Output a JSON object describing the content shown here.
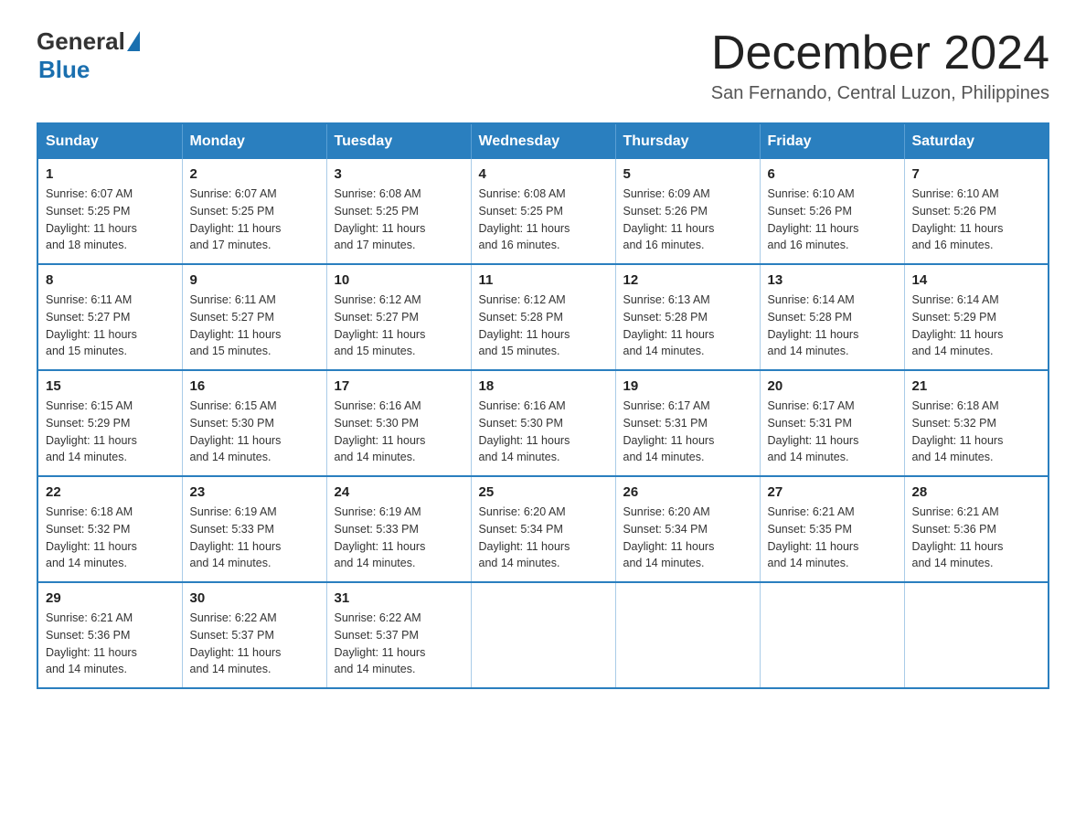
{
  "logo": {
    "general": "General",
    "blue": "Blue",
    "triangle": "▶"
  },
  "title": {
    "month_year": "December 2024",
    "location": "San Fernando, Central Luzon, Philippines"
  },
  "weekdays": [
    "Sunday",
    "Monday",
    "Tuesday",
    "Wednesday",
    "Thursday",
    "Friday",
    "Saturday"
  ],
  "weeks": [
    [
      {
        "day": "1",
        "sunrise": "6:07 AM",
        "sunset": "5:25 PM",
        "daylight": "11 hours and 18 minutes."
      },
      {
        "day": "2",
        "sunrise": "6:07 AM",
        "sunset": "5:25 PM",
        "daylight": "11 hours and 17 minutes."
      },
      {
        "day": "3",
        "sunrise": "6:08 AM",
        "sunset": "5:25 PM",
        "daylight": "11 hours and 17 minutes."
      },
      {
        "day": "4",
        "sunrise": "6:08 AM",
        "sunset": "5:25 PM",
        "daylight": "11 hours and 16 minutes."
      },
      {
        "day": "5",
        "sunrise": "6:09 AM",
        "sunset": "5:26 PM",
        "daylight": "11 hours and 16 minutes."
      },
      {
        "day": "6",
        "sunrise": "6:10 AM",
        "sunset": "5:26 PM",
        "daylight": "11 hours and 16 minutes."
      },
      {
        "day": "7",
        "sunrise": "6:10 AM",
        "sunset": "5:26 PM",
        "daylight": "11 hours and 16 minutes."
      }
    ],
    [
      {
        "day": "8",
        "sunrise": "6:11 AM",
        "sunset": "5:27 PM",
        "daylight": "11 hours and 15 minutes."
      },
      {
        "day": "9",
        "sunrise": "6:11 AM",
        "sunset": "5:27 PM",
        "daylight": "11 hours and 15 minutes."
      },
      {
        "day": "10",
        "sunrise": "6:12 AM",
        "sunset": "5:27 PM",
        "daylight": "11 hours and 15 minutes."
      },
      {
        "day": "11",
        "sunrise": "6:12 AM",
        "sunset": "5:28 PM",
        "daylight": "11 hours and 15 minutes."
      },
      {
        "day": "12",
        "sunrise": "6:13 AM",
        "sunset": "5:28 PM",
        "daylight": "11 hours and 14 minutes."
      },
      {
        "day": "13",
        "sunrise": "6:14 AM",
        "sunset": "5:28 PM",
        "daylight": "11 hours and 14 minutes."
      },
      {
        "day": "14",
        "sunrise": "6:14 AM",
        "sunset": "5:29 PM",
        "daylight": "11 hours and 14 minutes."
      }
    ],
    [
      {
        "day": "15",
        "sunrise": "6:15 AM",
        "sunset": "5:29 PM",
        "daylight": "11 hours and 14 minutes."
      },
      {
        "day": "16",
        "sunrise": "6:15 AM",
        "sunset": "5:30 PM",
        "daylight": "11 hours and 14 minutes."
      },
      {
        "day": "17",
        "sunrise": "6:16 AM",
        "sunset": "5:30 PM",
        "daylight": "11 hours and 14 minutes."
      },
      {
        "day": "18",
        "sunrise": "6:16 AM",
        "sunset": "5:30 PM",
        "daylight": "11 hours and 14 minutes."
      },
      {
        "day": "19",
        "sunrise": "6:17 AM",
        "sunset": "5:31 PM",
        "daylight": "11 hours and 14 minutes."
      },
      {
        "day": "20",
        "sunrise": "6:17 AM",
        "sunset": "5:31 PM",
        "daylight": "11 hours and 14 minutes."
      },
      {
        "day": "21",
        "sunrise": "6:18 AM",
        "sunset": "5:32 PM",
        "daylight": "11 hours and 14 minutes."
      }
    ],
    [
      {
        "day": "22",
        "sunrise": "6:18 AM",
        "sunset": "5:32 PM",
        "daylight": "11 hours and 14 minutes."
      },
      {
        "day": "23",
        "sunrise": "6:19 AM",
        "sunset": "5:33 PM",
        "daylight": "11 hours and 14 minutes."
      },
      {
        "day": "24",
        "sunrise": "6:19 AM",
        "sunset": "5:33 PM",
        "daylight": "11 hours and 14 minutes."
      },
      {
        "day": "25",
        "sunrise": "6:20 AM",
        "sunset": "5:34 PM",
        "daylight": "11 hours and 14 minutes."
      },
      {
        "day": "26",
        "sunrise": "6:20 AM",
        "sunset": "5:34 PM",
        "daylight": "11 hours and 14 minutes."
      },
      {
        "day": "27",
        "sunrise": "6:21 AM",
        "sunset": "5:35 PM",
        "daylight": "11 hours and 14 minutes."
      },
      {
        "day": "28",
        "sunrise": "6:21 AM",
        "sunset": "5:36 PM",
        "daylight": "11 hours and 14 minutes."
      }
    ],
    [
      {
        "day": "29",
        "sunrise": "6:21 AM",
        "sunset": "5:36 PM",
        "daylight": "11 hours and 14 minutes."
      },
      {
        "day": "30",
        "sunrise": "6:22 AM",
        "sunset": "5:37 PM",
        "daylight": "11 hours and 14 minutes."
      },
      {
        "day": "31",
        "sunrise": "6:22 AM",
        "sunset": "5:37 PM",
        "daylight": "11 hours and 14 minutes."
      },
      null,
      null,
      null,
      null
    ]
  ],
  "labels": {
    "sunrise": "Sunrise:",
    "sunset": "Sunset:",
    "daylight": "Daylight:"
  }
}
